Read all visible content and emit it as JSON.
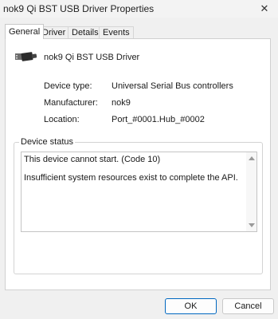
{
  "window": {
    "title": "nok9 Qi BST USB Driver Properties",
    "close_glyph": "✕"
  },
  "tabs": [
    {
      "label": "General",
      "active": true
    },
    {
      "label": "Driver",
      "active": false
    },
    {
      "label": "Details",
      "active": false
    },
    {
      "label": "Events",
      "active": false
    }
  ],
  "device": {
    "name": "nok9 Qi BST USB Driver",
    "icon": "usb-connector-icon"
  },
  "properties": [
    {
      "label": "Device type:",
      "value": "Universal Serial Bus controllers"
    },
    {
      "label": "Manufacturer:",
      "value": "nok9"
    },
    {
      "label": "Location:",
      "value": "Port_#0001.Hub_#0002"
    }
  ],
  "device_status": {
    "group_label": "Device status",
    "lines": [
      "This device cannot start. (Code 10)",
      "Insufficient system resources exist to complete the API."
    ]
  },
  "buttons": {
    "ok": "OK",
    "cancel": "Cancel"
  },
  "colors": {
    "default_button_border": "#0067c0",
    "window_background": "#f0f0f0"
  }
}
